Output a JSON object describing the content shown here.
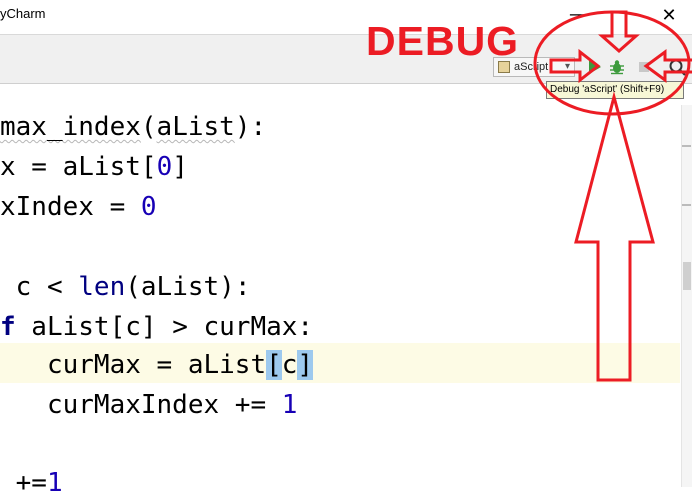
{
  "window": {
    "title": "yCharm",
    "minimize_label": "—",
    "close_label": "✕"
  },
  "toolbar": {
    "run_config": "aScript",
    "run_icon": "run-icon",
    "debug_icon": "bug-icon",
    "stop_icon": "stop-icon",
    "search_icon": "search-icon"
  },
  "tooltip": {
    "text": "Debug 'aScript' (Shift+F9)"
  },
  "annotation": {
    "label": "DEBUG",
    "color": "#ec1c24"
  },
  "editor": {
    "line1": {
      "name": "max_index",
      "open": "(",
      "param": "aList",
      "close": "):"
    },
    "line2": {
      "var": "x",
      "eq": " = ",
      "name": "aList",
      "lb": "[",
      "num": "0",
      "rb": "]"
    },
    "line3": {
      "var": "xIndex",
      "eq": " = ",
      "num": "0"
    },
    "line5": {
      "pre": " c < ",
      "builtin": "len",
      "rest": "(aList):"
    },
    "line6": {
      "kw": "f",
      "rest": " aList[c] > curMax:"
    },
    "line7": {
      "pre": "   curMax = aList",
      "lb": "[",
      "mid": "c",
      "rb": "]"
    },
    "line8": {
      "pre": "   curMaxIndex += ",
      "num": "1"
    },
    "line10": {
      "pre": " +=",
      "num": "1"
    }
  },
  "colors": {
    "number": "#1700b5",
    "keyword": "#000080",
    "current_line": "#fdfbe5",
    "bracket_highlight": "#9dc9ee",
    "tooltip_bg": "#f7f7d6"
  }
}
